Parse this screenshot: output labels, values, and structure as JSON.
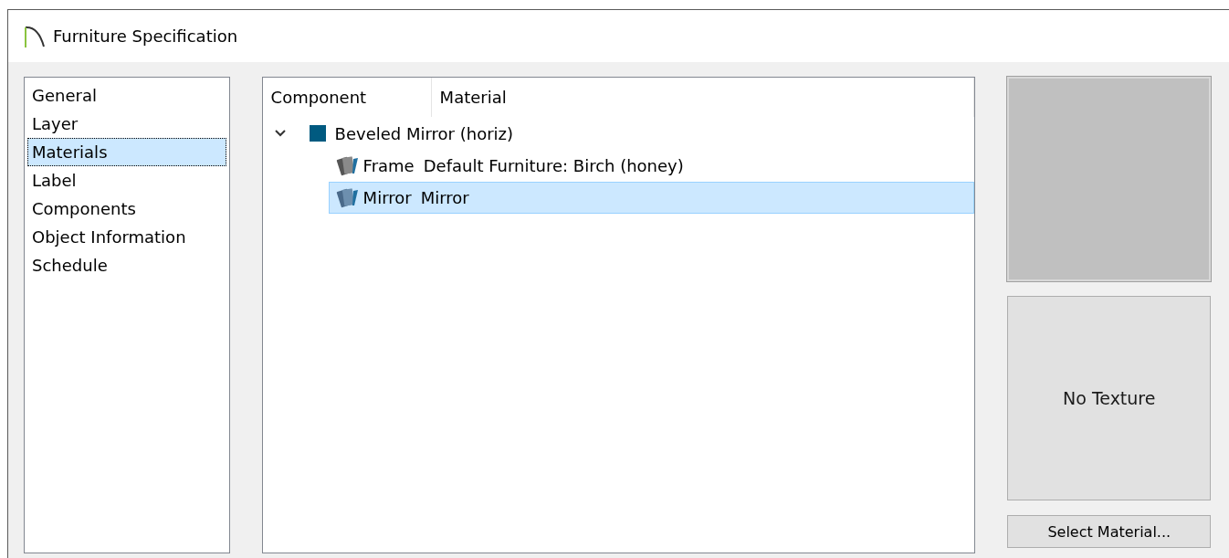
{
  "window": {
    "title": "Furniture Specification"
  },
  "sidebar": {
    "items": [
      {
        "label": "General",
        "selected": false
      },
      {
        "label": "Layer",
        "selected": false
      },
      {
        "label": "Materials",
        "selected": true
      },
      {
        "label": "Label",
        "selected": false
      },
      {
        "label": "Components",
        "selected": false
      },
      {
        "label": "Object Information",
        "selected": false
      },
      {
        "label": "Schedule",
        "selected": false
      }
    ]
  },
  "tree": {
    "columns": [
      "Component",
      "Material"
    ],
    "root": {
      "name": "Beveled Mirror (horiz)",
      "color": "#005a80",
      "expanded": true,
      "children": [
        {
          "component": "Frame",
          "material": "Default Furniture: Birch (honey)",
          "selected": false
        },
        {
          "component": "Mirror",
          "material": "Mirror",
          "selected": true
        }
      ]
    }
  },
  "preview": {
    "texture_label": "No Texture"
  },
  "buttons": [
    "Select Material..."
  ]
}
